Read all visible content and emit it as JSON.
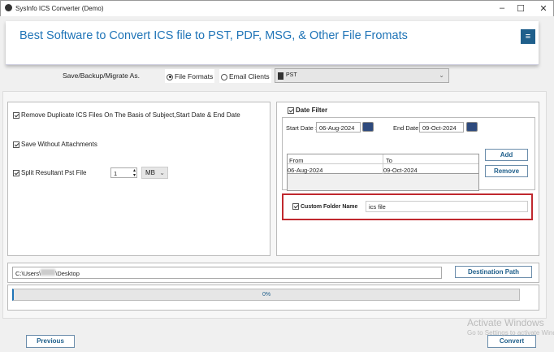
{
  "window": {
    "title": "SysInfo ICS Converter (Demo)",
    "minimize": "–",
    "maximize": "☐",
    "close": "✕"
  },
  "banner": {
    "title": "Best Software to Convert ICS file to PST, PDF, MSG, & Other File Fromats",
    "menu_icon": "≡"
  },
  "save_as": {
    "label": "Save/Backup/Migrate As.",
    "option_file": "File Formats",
    "option_email": "Email Clients",
    "selected_format": "PST",
    "selected_option": "File Formats"
  },
  "options": {
    "remove_duplicates": "Remove Duplicate ICS Files On The Basis of Subject,Start Date & End Date",
    "save_without_attachments": "Save Without Attachments",
    "split_pst": "Split Resultant Pst File",
    "split_size": "1",
    "split_unit": "MB"
  },
  "date_filter": {
    "label": "Date Filter",
    "start_label": "Start Date :",
    "start_value": "06-Aug-2024",
    "end_label": "End Date :",
    "end_value": "09-Oct-2024",
    "columns": [
      "From",
      "To"
    ],
    "rows": [
      [
        "06-Aug-2024",
        "09-Oct-2024"
      ]
    ],
    "add": "Add",
    "remove": "Remove"
  },
  "custom_folder": {
    "label": "Custom Folder Name",
    "value": "ics file"
  },
  "destination": {
    "path_start": "C:\\Users\\",
    "path_end": "\\Desktop",
    "button": "Destination Path"
  },
  "progress": {
    "value": "0%",
    "percent": 0
  },
  "footer": {
    "previous": "Previous",
    "convert": "Convert"
  },
  "watermark": {
    "line1": "Activate Windows",
    "line2": "Go to Settings to activate Windows."
  }
}
